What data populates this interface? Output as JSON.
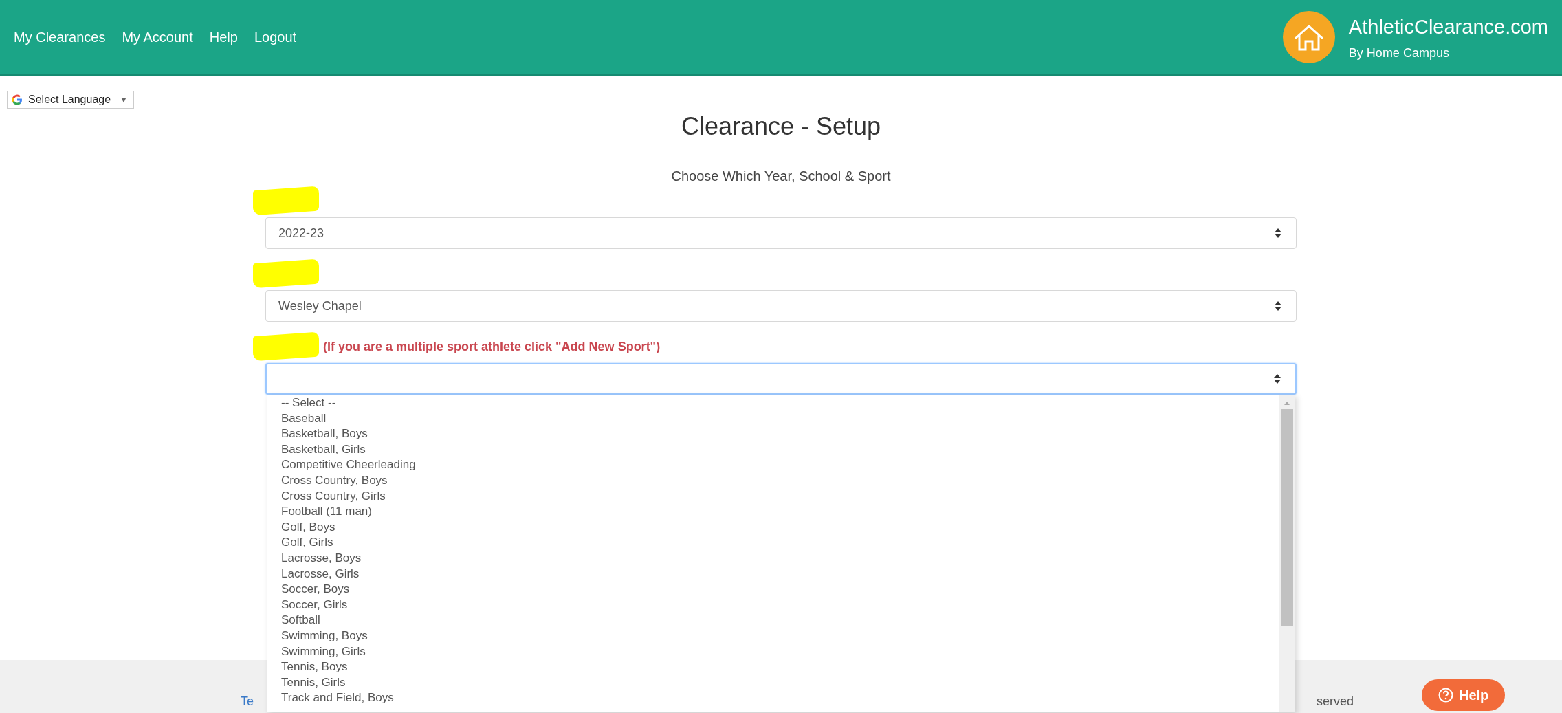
{
  "nav": {
    "links": [
      "My Clearances",
      "My Account",
      "Help",
      "Logout"
    ]
  },
  "brand": {
    "title": "AthleticClearance.com",
    "subtitle": "By Home Campus"
  },
  "translate": {
    "label": "Select Language",
    "caret": "▼"
  },
  "page": {
    "title": "Clearance - Setup",
    "subtitle": "Choose Which Year, School & Sport"
  },
  "fields": [
    {
      "redacted": true,
      "value": "2022-23",
      "focused": false
    },
    {
      "redacted": true,
      "value": "Wesley Chapel",
      "focused": false
    },
    {
      "redacted": true,
      "note": "(If you are a multiple sport athlete click \"Add New Sport\")",
      "focused": true
    }
  ],
  "dropdown": {
    "options": [
      {
        "label": "-- Select --",
        "selected": false
      },
      {
        "label": "Baseball",
        "selected": false
      },
      {
        "label": "Basketball, Boys",
        "selected": false
      },
      {
        "label": "Basketball, Girls",
        "selected": false
      },
      {
        "label": "Competitive Cheerleading",
        "selected": false
      },
      {
        "label": "Cross Country, Boys",
        "selected": false
      },
      {
        "label": "Cross Country, Girls",
        "selected": false
      },
      {
        "label": "Football (11 man)",
        "selected": false
      },
      {
        "label": "Golf, Boys",
        "selected": false
      },
      {
        "label": "Golf, Girls",
        "selected": false
      },
      {
        "label": "Lacrosse, Boys",
        "selected": false
      },
      {
        "label": "Lacrosse, Girls",
        "selected": false
      },
      {
        "label": "Soccer, Boys",
        "selected": false
      },
      {
        "label": "Soccer, Girls",
        "selected": false
      },
      {
        "label": "Softball",
        "selected": false
      },
      {
        "label": "Swimming, Boys",
        "selected": false
      },
      {
        "label": "Swimming, Girls",
        "selected": false
      },
      {
        "label": "Tennis, Boys",
        "selected": false
      },
      {
        "label": "Tennis, Girls",
        "selected": false
      },
      {
        "label": "Track and Field, Boys",
        "selected": false
      }
    ]
  },
  "footer": {
    "left": "Te",
    "right": "served"
  },
  "help_button": {
    "label": "Help"
  }
}
